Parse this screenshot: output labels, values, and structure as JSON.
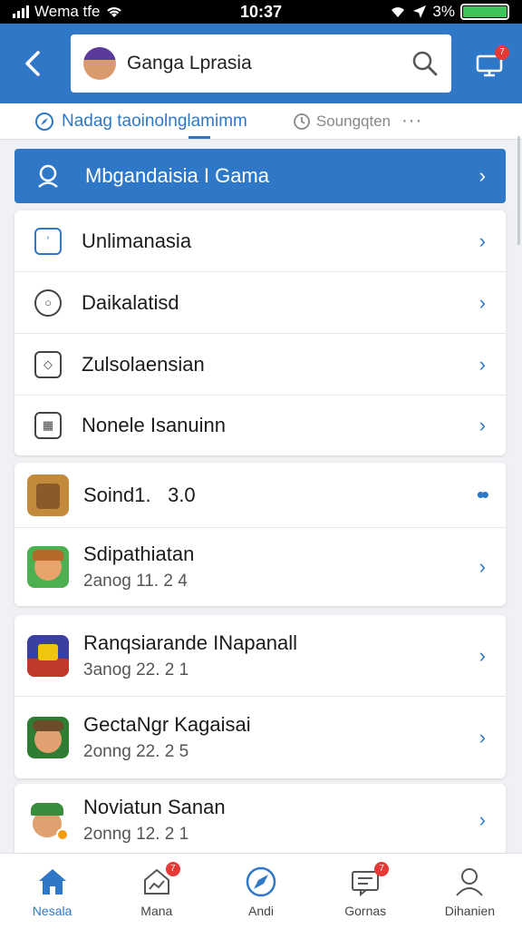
{
  "status_bar": {
    "carrier": "Wema tfe",
    "time": "10:37",
    "battery_percent": "3%"
  },
  "header": {
    "title": "Ganga Lprasia",
    "notification_badge": "7"
  },
  "tabs": {
    "active": "Nadag taoinolnglamimm",
    "other": "Soungqten",
    "more": "···"
  },
  "banner": {
    "label": "Mbgandaisia I Gama"
  },
  "menu": {
    "items": [
      {
        "label": "Unlimanasia",
        "icon": "clock-icon"
      },
      {
        "label": "Daikalatisd",
        "icon": "circle-icon"
      },
      {
        "label": "Zulsolaensian",
        "icon": "shield-icon"
      },
      {
        "label": "Nonele Isanuinn",
        "icon": "calendar-icon"
      }
    ]
  },
  "apps_card1": {
    "items": [
      {
        "title": "Soind1.",
        "version": "3.0"
      },
      {
        "title": "Sdipathiatan",
        "sub": "2anog 11. 2 4"
      }
    ]
  },
  "apps_card2": {
    "items": [
      {
        "title": "Ranqsiarande INapanall",
        "sub": "3anog 22. 2 1"
      },
      {
        "title": "GectaNgr Kagaisai",
        "sub": "2onng 22. 2 5"
      }
    ]
  },
  "apps_card3": {
    "items": [
      {
        "title": "Noviatun Sanan",
        "sub": "2onng 12. 2 1"
      }
    ]
  },
  "bottom_nav": {
    "items": [
      {
        "label": "Nesala",
        "icon": "home-icon"
      },
      {
        "label": "Mana",
        "icon": "house-chart-icon",
        "badge": "7"
      },
      {
        "label": "Andi",
        "icon": "compass-icon"
      },
      {
        "label": "Gornas",
        "icon": "message-icon",
        "badge": "7"
      },
      {
        "label": "Dihanien",
        "icon": "person-icon"
      }
    ]
  },
  "colors": {
    "accent": "#2f78c8",
    "badge": "#e53935",
    "battery": "#3cc45a"
  }
}
